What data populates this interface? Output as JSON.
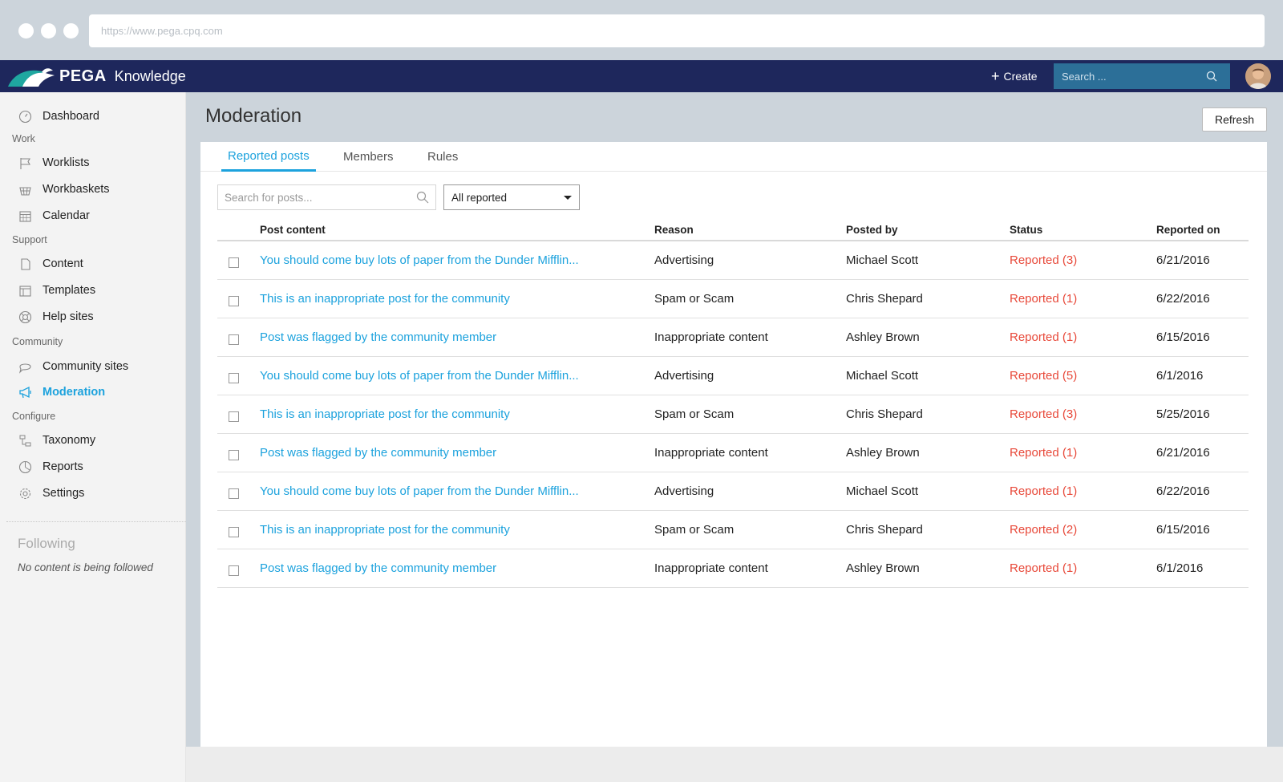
{
  "browser": {
    "url": "https://www.pega.cpq.com"
  },
  "header": {
    "brand": "PEGA",
    "app_name": "Knowledge",
    "create_label": "Create",
    "search_placeholder": "Search ..."
  },
  "sidebar": {
    "sections": {
      "work": "Work",
      "support": "Support",
      "community": "Community",
      "configure": "Configure"
    },
    "items": {
      "dashboard": "Dashboard",
      "worklists": "Worklists",
      "workbaskets": "Workbaskets",
      "calendar": "Calendar",
      "content": "Content",
      "templates": "Templates",
      "help_sites": "Help sites",
      "community_sites": "Community sites",
      "moderation": "Moderation",
      "taxonomy": "Taxonomy",
      "reports": "Reports",
      "settings": "Settings"
    },
    "following": {
      "title": "Following",
      "empty": "No content is being followed"
    }
  },
  "main": {
    "title": "Moderation",
    "refresh_label": "Refresh",
    "tabs": [
      "Reported posts",
      "Members",
      "Rules"
    ],
    "filter": {
      "search_placeholder": "Search for posts...",
      "select_value": "All reported"
    },
    "columns": [
      "Post content",
      "Reason",
      "Posted by",
      "Status",
      "Reported on"
    ],
    "rows": [
      [
        "You should come buy lots of paper from the Dunder Mifflin...",
        "Advertising",
        "Michael Scott",
        "Reported (3)",
        "6/21/2016"
      ],
      [
        "This is an inappropriate post for the community",
        "Spam or Scam",
        "Chris Shepard",
        "Reported (1)",
        "6/22/2016"
      ],
      [
        "Post was flagged by the community member",
        "Inappropriate content",
        "Ashley Brown",
        "Reported (1)",
        "6/15/2016"
      ],
      [
        "You should come buy lots of paper from the Dunder Mifflin...",
        "Advertising",
        "Michael Scott",
        "Reported (5)",
        "6/1/2016"
      ],
      [
        "This is an inappropriate post for the community",
        "Spam or Scam",
        "Chris Shepard",
        "Reported (3)",
        "5/25/2016"
      ],
      [
        "Post was flagged by the community member",
        "Inappropriate content",
        "Ashley Brown",
        "Reported (1)",
        "6/21/2016"
      ],
      [
        "You should come buy lots of paper from the Dunder Mifflin...",
        "Advertising",
        "Michael Scott",
        "Reported (1)",
        "6/22/2016"
      ],
      [
        "This is an inappropriate post for the community",
        "Spam or Scam",
        "Chris Shepard",
        "Reported (2)",
        "6/15/2016"
      ],
      [
        "Post was flagged by the community member",
        "Inappropriate content",
        "Ashley Brown",
        "Reported (1)",
        "6/1/2016"
      ]
    ]
  },
  "colors": {
    "header_bg": "#1e275c",
    "accent": "#1ca2dd",
    "status_red": "#e8493a",
    "search_bg": "#2c6f98"
  }
}
